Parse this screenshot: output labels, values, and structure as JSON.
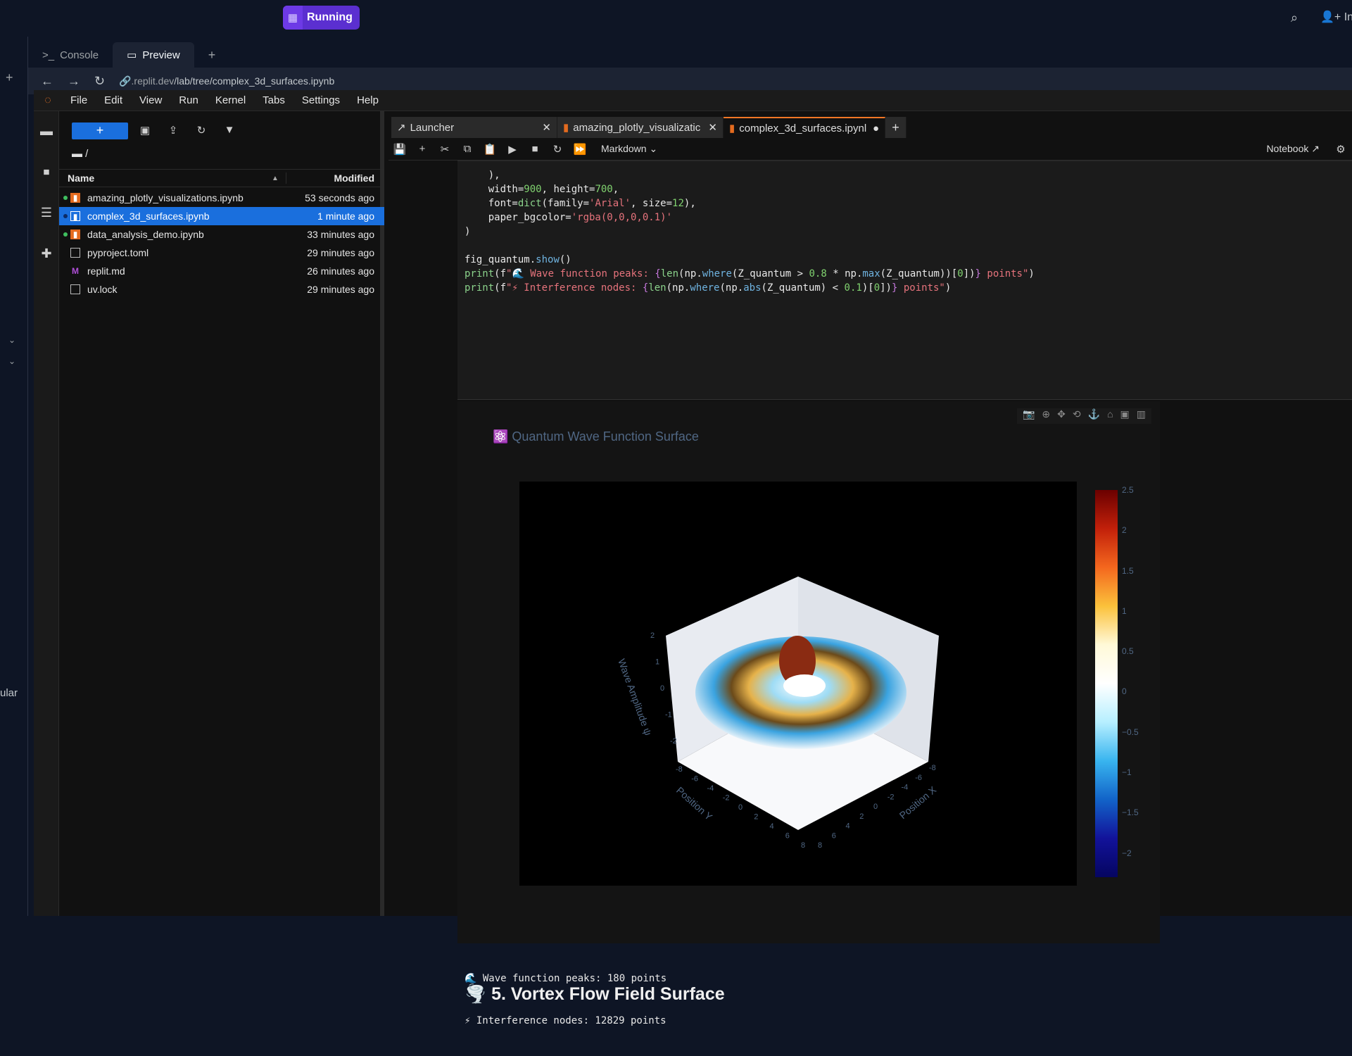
{
  "topbar": {
    "run_status": "Running",
    "invite_label": "Inv"
  },
  "workspace_tabs": [
    {
      "label": "Console"
    },
    {
      "label": "Preview"
    }
  ],
  "browser": {
    "url_prefix": ".replit.dev",
    "url_path": "/lab/tree/complex_3d_surfaces.ipynb"
  },
  "left_edge": {
    "partial_text": "ular"
  },
  "menu": [
    "File",
    "Edit",
    "View",
    "Run",
    "Kernel",
    "Tabs",
    "Settings",
    "Help"
  ],
  "file_browser": {
    "breadcrumb": "/",
    "col_name": "Name",
    "col_modified": "Modified",
    "files": [
      {
        "name": "amazing_plotly_visualizations.ipynb",
        "modified": "53 seconds ago",
        "running": true,
        "type": "notebook"
      },
      {
        "name": "complex_3d_surfaces.ipynb",
        "modified": "1 minute ago",
        "running": true,
        "type": "notebook",
        "selected": true
      },
      {
        "name": "data_analysis_demo.ipynb",
        "modified": "33 minutes ago",
        "running": true,
        "type": "notebook"
      },
      {
        "name": "pyproject.toml",
        "modified": "29 minutes ago",
        "running": false,
        "type": "file"
      },
      {
        "name": "replit.md",
        "modified": "26 minutes ago",
        "running": false,
        "type": "markdown"
      },
      {
        "name": "uv.lock",
        "modified": "29 minutes ago",
        "running": false,
        "type": "file"
      }
    ]
  },
  "doc_tabs": [
    {
      "label": "Launcher"
    },
    {
      "label": "amazing_plotly_visualizatic"
    },
    {
      "label": "complex_3d_surfaces.ipynl"
    }
  ],
  "notebook_toolbar": {
    "cell_type": "Markdown",
    "kernel_label": "Notebook"
  },
  "code_lines": [
    "    ),",
    "    width=900, height=700,",
    "    font=dict(family='Arial', size=12),",
    "    paper_bgcolor='rgba(0,0,0,0.1)'",
    ")",
    "",
    "fig_quantum.show()",
    "print(f\"🌊 Wave function peaks: {len(np.where(Z_quantum > 0.8 * np.max(Z_quantum))[0])} points\")",
    "print(f\"⚡ Interference nodes: {len(np.where(np.abs(Z_quantum) < 0.1)[0])} points\")"
  ],
  "chart_data": {
    "type": "surface",
    "title": "⚛️ Quantum Wave Function Surface",
    "xlabel": "Position X",
    "ylabel": "Position Y",
    "zlabel": "Wave Amplitude ψ",
    "x_ticks": [
      "-8",
      "-6",
      "-4",
      "-2",
      "0",
      "2",
      "4",
      "6",
      "8"
    ],
    "y_ticks": [
      "-8",
      "-6",
      "-4",
      "-2",
      "0",
      "2",
      "4",
      "6",
      "8"
    ],
    "z_ticks": [
      "-2",
      "-1",
      "0",
      "1",
      "2"
    ],
    "colorscale": [
      "#6b0000",
      "#c2200a",
      "#f4671e",
      "#fbc13b",
      "#ffffff",
      "#38b4ef",
      "#1263c8",
      "#050560"
    ],
    "colorbar_ticks": [
      "2.5",
      "2",
      "1.5",
      "1",
      "0.5",
      "0",
      "−0.5",
      "−1",
      "−1.5",
      "−2"
    ],
    "colorbar_range": [
      -2.3,
      2.5
    ]
  },
  "output_lines": [
    "🌊 Wave function peaks: 180 points",
    "⚡ Interference nodes: 12829 points"
  ],
  "next_heading": "🌪️ 5. Vortex Flow Field Surface"
}
